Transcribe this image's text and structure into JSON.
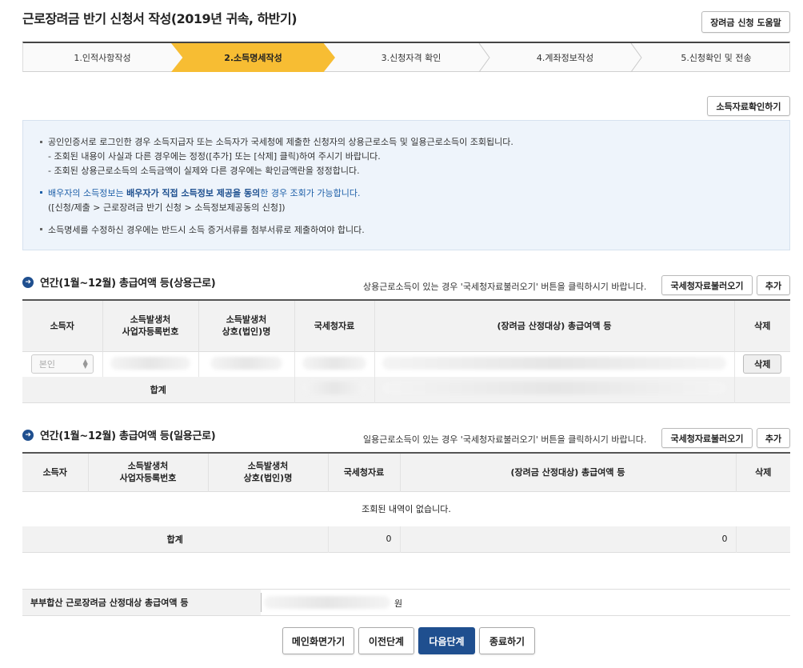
{
  "page": {
    "title": "근로장려금 반기 신청서 작성(2019년 귀속, 하반기)",
    "help_button": "장려금 신청 도움말"
  },
  "steps": [
    {
      "label": "1.인적사항작성",
      "active": false
    },
    {
      "label": "2.소득명세작성",
      "active": true
    },
    {
      "label": "3.신청자격 확인",
      "active": false
    },
    {
      "label": "4.계좌정보작성",
      "active": false
    },
    {
      "label": "5.신청확인 및 전송",
      "active": false
    }
  ],
  "income_check_button": "소득자료확인하기",
  "info": {
    "line1": "공인인증서로 로그인한 경우 소득지급자 또는 소득자가 국세청에 제출한 신청자의 상용근로소득 및 일용근로소득이 조회됩니다.",
    "line2": "- 조회된 내용이 사실과 다른 경우에는 정정([추가] 또는 [삭제] 클릭)하여 주시기 바랍니다.",
    "line3": "- 조회된 상용근로소득의 소득금액이 실제와 다른 경우에는 확인금액란을 정정합니다.",
    "line4_a": "배우자의 소득정보는 ",
    "line4_b": "배우자가 직접 소득정보 제공을 동의",
    "line4_c": "한 경우 조회가 가능합니다.",
    "line5": "([신청/제출 > 근로장려금 반기 신청 > 소득정보제공동의 신청])",
    "line6": "소득명세를 수정하신 경우에는 반드시 소득 증거서류를 첨부서류로 제출하여야 합니다."
  },
  "regular": {
    "title": "연간(1월~12월) 총급여액 등(상용근로)",
    "note": "상용근로소득이 있는 경우 '국세청자료불러오기' 버튼을 클릭하시기 바랍니다.",
    "load_button": "국세청자료불러오기",
    "add_button": "추가",
    "headers": {
      "earner": "소득자",
      "biz_no_1": "소득발생처",
      "biz_no_2": "사업자등록번호",
      "biz_name_1": "소득발생처",
      "biz_name_2": "상호(법인)명",
      "nts": "국세청자료",
      "amount": "(장려금 산정대상) 총급여액 등",
      "delete": "삭제"
    },
    "row": {
      "earner_select": "본인",
      "delete_button": "삭제"
    },
    "sum_label": "합계"
  },
  "daily": {
    "title": "연간(1월~12월) 총급여액 등(일용근로)",
    "note": "일용근로소득이 있는 경우 '국세청자료불러오기' 버튼을 클릭하시기 바랍니다.",
    "load_button": "국세청자료불러오기",
    "add_button": "추가",
    "headers": {
      "earner": "소득자",
      "biz_no_1": "소득발생처",
      "biz_no_2": "사업자등록번호",
      "biz_name_1": "소득발생처",
      "biz_name_2": "상호(법인)명",
      "nts": "국세청자료",
      "amount": "(장려금 산정대상) 총급여액 등",
      "delete": "삭제"
    },
    "empty_message": "조회된 내역이 없습니다.",
    "sum_label": "합계",
    "sum_nts": "0",
    "sum_amount": "0"
  },
  "couple_total": {
    "label": "부부합산 근로장려금 산정대상 총급여액 등",
    "unit": "원"
  },
  "buttons": {
    "main": "메인화면가기",
    "prev": "이전단계",
    "next": "다음단계",
    "close": "종료하기"
  },
  "colors": {
    "accent": "#f7bd33",
    "primary": "#1f4f8f",
    "info_bg": "#eef4fb"
  }
}
